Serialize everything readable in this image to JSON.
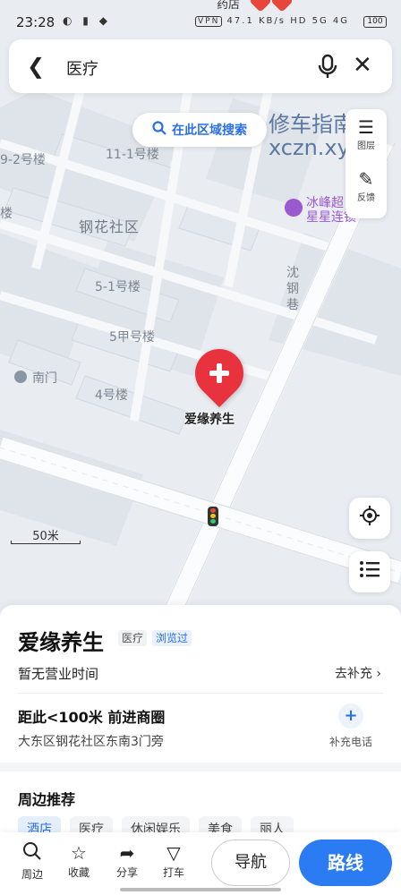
{
  "status_bar": {
    "time": "23:28",
    "vpn": "VPN",
    "net_speed": "47.1 KB/s",
    "signal": "HD 5G 4G",
    "battery": "100",
    "top_cut_text": "药店"
  },
  "search": {
    "query": "医疗"
  },
  "map": {
    "area_search_label": "在此区域搜索",
    "watermark_line1": "修车指南",
    "watermark_line2": "xczn.xyz",
    "labels": {
      "b9_2": "9-2号楼",
      "b11_1": "11-1号楼",
      "lou": "楼",
      "community": "钢花社区",
      "b5_1": "5-1号楼",
      "b5a": "5甲号楼",
      "south_gate": "南门",
      "b4": "4号楼",
      "ice_name": "冰峰超",
      "ice_sub": "星星连锁",
      "street": "沈钢巷"
    },
    "poi_name": "爱缘养生",
    "scale": "50米",
    "layer_label": "图层",
    "feedback_label": "反馈"
  },
  "card": {
    "title": "爱缘养生",
    "category": "医疗",
    "viewed": "浏览过",
    "hours": "暂无营业时间",
    "supplement": "去补充",
    "distance": "距此<100米  前进商圈",
    "address": "大东区钢花社区东南3门旁",
    "add_phone": "补充电话",
    "nearby_title": "周边推荐",
    "chips": [
      "酒店",
      "医疗",
      "休闲娱乐",
      "美食",
      "丽人"
    ]
  },
  "bottom": {
    "nearby": "周边",
    "favorite": "收藏",
    "share": "分享",
    "taxi": "打车",
    "navigate": "导航",
    "route": "路线"
  },
  "colors": {
    "accent": "#2b7cf2",
    "pin": "#e8333e",
    "map_bg": "#e9edf2"
  }
}
